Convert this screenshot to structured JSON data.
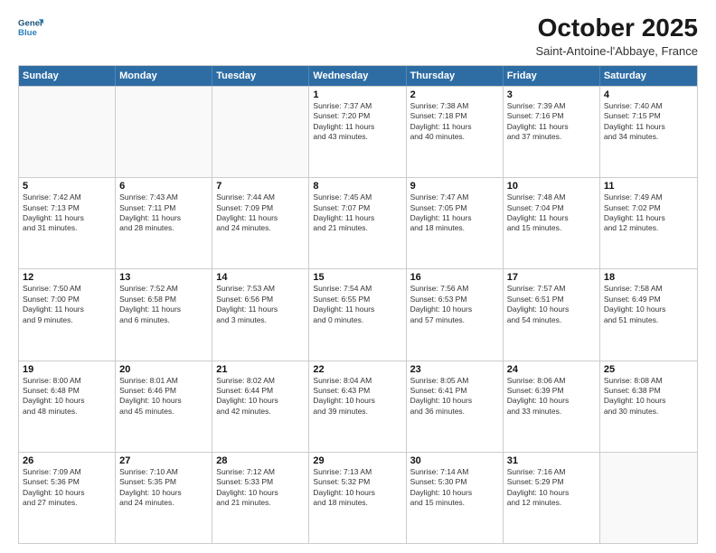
{
  "logo": {
    "line1": "General",
    "line2": "Blue"
  },
  "title": "October 2025",
  "location": "Saint-Antoine-l'Abbaye, France",
  "days": [
    "Sunday",
    "Monday",
    "Tuesday",
    "Wednesday",
    "Thursday",
    "Friday",
    "Saturday"
  ],
  "weeks": [
    [
      {
        "day": "",
        "text": ""
      },
      {
        "day": "",
        "text": ""
      },
      {
        "day": "",
        "text": ""
      },
      {
        "day": "1",
        "text": "Sunrise: 7:37 AM\nSunset: 7:20 PM\nDaylight: 11 hours\nand 43 minutes."
      },
      {
        "day": "2",
        "text": "Sunrise: 7:38 AM\nSunset: 7:18 PM\nDaylight: 11 hours\nand 40 minutes."
      },
      {
        "day": "3",
        "text": "Sunrise: 7:39 AM\nSunset: 7:16 PM\nDaylight: 11 hours\nand 37 minutes."
      },
      {
        "day": "4",
        "text": "Sunrise: 7:40 AM\nSunset: 7:15 PM\nDaylight: 11 hours\nand 34 minutes."
      }
    ],
    [
      {
        "day": "5",
        "text": "Sunrise: 7:42 AM\nSunset: 7:13 PM\nDaylight: 11 hours\nand 31 minutes."
      },
      {
        "day": "6",
        "text": "Sunrise: 7:43 AM\nSunset: 7:11 PM\nDaylight: 11 hours\nand 28 minutes."
      },
      {
        "day": "7",
        "text": "Sunrise: 7:44 AM\nSunset: 7:09 PM\nDaylight: 11 hours\nand 24 minutes."
      },
      {
        "day": "8",
        "text": "Sunrise: 7:45 AM\nSunset: 7:07 PM\nDaylight: 11 hours\nand 21 minutes."
      },
      {
        "day": "9",
        "text": "Sunrise: 7:47 AM\nSunset: 7:05 PM\nDaylight: 11 hours\nand 18 minutes."
      },
      {
        "day": "10",
        "text": "Sunrise: 7:48 AM\nSunset: 7:04 PM\nDaylight: 11 hours\nand 15 minutes."
      },
      {
        "day": "11",
        "text": "Sunrise: 7:49 AM\nSunset: 7:02 PM\nDaylight: 11 hours\nand 12 minutes."
      }
    ],
    [
      {
        "day": "12",
        "text": "Sunrise: 7:50 AM\nSunset: 7:00 PM\nDaylight: 11 hours\nand 9 minutes."
      },
      {
        "day": "13",
        "text": "Sunrise: 7:52 AM\nSunset: 6:58 PM\nDaylight: 11 hours\nand 6 minutes."
      },
      {
        "day": "14",
        "text": "Sunrise: 7:53 AM\nSunset: 6:56 PM\nDaylight: 11 hours\nand 3 minutes."
      },
      {
        "day": "15",
        "text": "Sunrise: 7:54 AM\nSunset: 6:55 PM\nDaylight: 11 hours\nand 0 minutes."
      },
      {
        "day": "16",
        "text": "Sunrise: 7:56 AM\nSunset: 6:53 PM\nDaylight: 10 hours\nand 57 minutes."
      },
      {
        "day": "17",
        "text": "Sunrise: 7:57 AM\nSunset: 6:51 PM\nDaylight: 10 hours\nand 54 minutes."
      },
      {
        "day": "18",
        "text": "Sunrise: 7:58 AM\nSunset: 6:49 PM\nDaylight: 10 hours\nand 51 minutes."
      }
    ],
    [
      {
        "day": "19",
        "text": "Sunrise: 8:00 AM\nSunset: 6:48 PM\nDaylight: 10 hours\nand 48 minutes."
      },
      {
        "day": "20",
        "text": "Sunrise: 8:01 AM\nSunset: 6:46 PM\nDaylight: 10 hours\nand 45 minutes."
      },
      {
        "day": "21",
        "text": "Sunrise: 8:02 AM\nSunset: 6:44 PM\nDaylight: 10 hours\nand 42 minutes."
      },
      {
        "day": "22",
        "text": "Sunrise: 8:04 AM\nSunset: 6:43 PM\nDaylight: 10 hours\nand 39 minutes."
      },
      {
        "day": "23",
        "text": "Sunrise: 8:05 AM\nSunset: 6:41 PM\nDaylight: 10 hours\nand 36 minutes."
      },
      {
        "day": "24",
        "text": "Sunrise: 8:06 AM\nSunset: 6:39 PM\nDaylight: 10 hours\nand 33 minutes."
      },
      {
        "day": "25",
        "text": "Sunrise: 8:08 AM\nSunset: 6:38 PM\nDaylight: 10 hours\nand 30 minutes."
      }
    ],
    [
      {
        "day": "26",
        "text": "Sunrise: 7:09 AM\nSunset: 5:36 PM\nDaylight: 10 hours\nand 27 minutes."
      },
      {
        "day": "27",
        "text": "Sunrise: 7:10 AM\nSunset: 5:35 PM\nDaylight: 10 hours\nand 24 minutes."
      },
      {
        "day": "28",
        "text": "Sunrise: 7:12 AM\nSunset: 5:33 PM\nDaylight: 10 hours\nand 21 minutes."
      },
      {
        "day": "29",
        "text": "Sunrise: 7:13 AM\nSunset: 5:32 PM\nDaylight: 10 hours\nand 18 minutes."
      },
      {
        "day": "30",
        "text": "Sunrise: 7:14 AM\nSunset: 5:30 PM\nDaylight: 10 hours\nand 15 minutes."
      },
      {
        "day": "31",
        "text": "Sunrise: 7:16 AM\nSunset: 5:29 PM\nDaylight: 10 hours\nand 12 minutes."
      },
      {
        "day": "",
        "text": ""
      }
    ]
  ]
}
